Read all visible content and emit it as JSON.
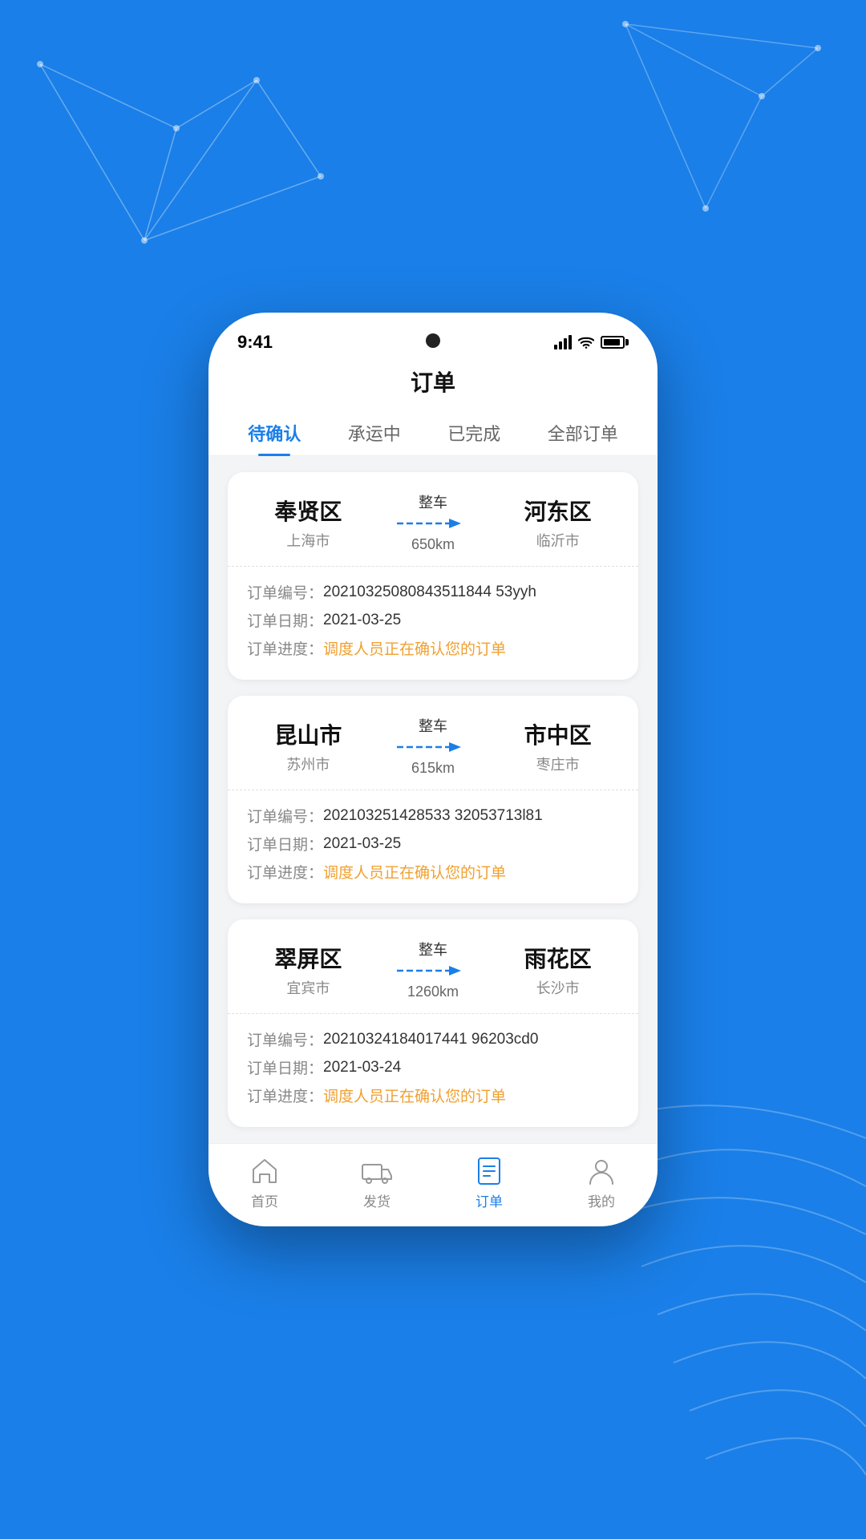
{
  "background": {
    "color": "#1a7fe8"
  },
  "status_bar": {
    "time": "9:41"
  },
  "page": {
    "title": "订单"
  },
  "tabs": [
    {
      "id": "pending",
      "label": "待确认",
      "active": true
    },
    {
      "id": "inprogress",
      "label": "承运中",
      "active": false
    },
    {
      "id": "completed",
      "label": "已完成",
      "active": false
    },
    {
      "id": "all",
      "label": "全部订单",
      "active": false
    }
  ],
  "orders": [
    {
      "id": "order1",
      "from_city": "奉贤区",
      "from_province": "上海市",
      "to_city": "河东区",
      "to_province": "临沂市",
      "type": "整车",
      "distance": "650km",
      "order_no_label": "订单编号：",
      "order_no": "20210325080843511844 53yyh",
      "order_date_label": "订单日期：",
      "order_date": "2021-03-25",
      "order_progress_label": "订单进度：",
      "order_progress": "调度人员正在确认您的订单"
    },
    {
      "id": "order2",
      "from_city": "昆山市",
      "from_province": "苏州市",
      "to_city": "市中区",
      "to_province": "枣庄市",
      "type": "整车",
      "distance": "615km",
      "order_no_label": "订单编号：",
      "order_no": "202103251428533 32053713l81",
      "order_date_label": "订单日期：",
      "order_date": "2021-03-25",
      "order_progress_label": "订单进度：",
      "order_progress": "调度人员正在确认您的订单"
    },
    {
      "id": "order3",
      "from_city": "翠屏区",
      "from_province": "宜宾市",
      "to_city": "雨花区",
      "to_province": "长沙市",
      "type": "整车",
      "distance": "1260km",
      "order_no_label": "订单编号：",
      "order_no": "20210324184017441 96203cd0",
      "order_date_label": "订单日期：",
      "order_date": "2021-03-24",
      "order_progress_label": "订单进度：",
      "order_progress": "调度人员正在确认您的订单"
    }
  ],
  "bottom_nav": [
    {
      "id": "home",
      "label": "首页",
      "active": false,
      "icon": "home-icon"
    },
    {
      "id": "ship",
      "label": "发货",
      "active": false,
      "icon": "truck-icon"
    },
    {
      "id": "order",
      "label": "订单",
      "active": true,
      "icon": "order-icon"
    },
    {
      "id": "mine",
      "label": "我的",
      "active": false,
      "icon": "user-icon"
    }
  ]
}
